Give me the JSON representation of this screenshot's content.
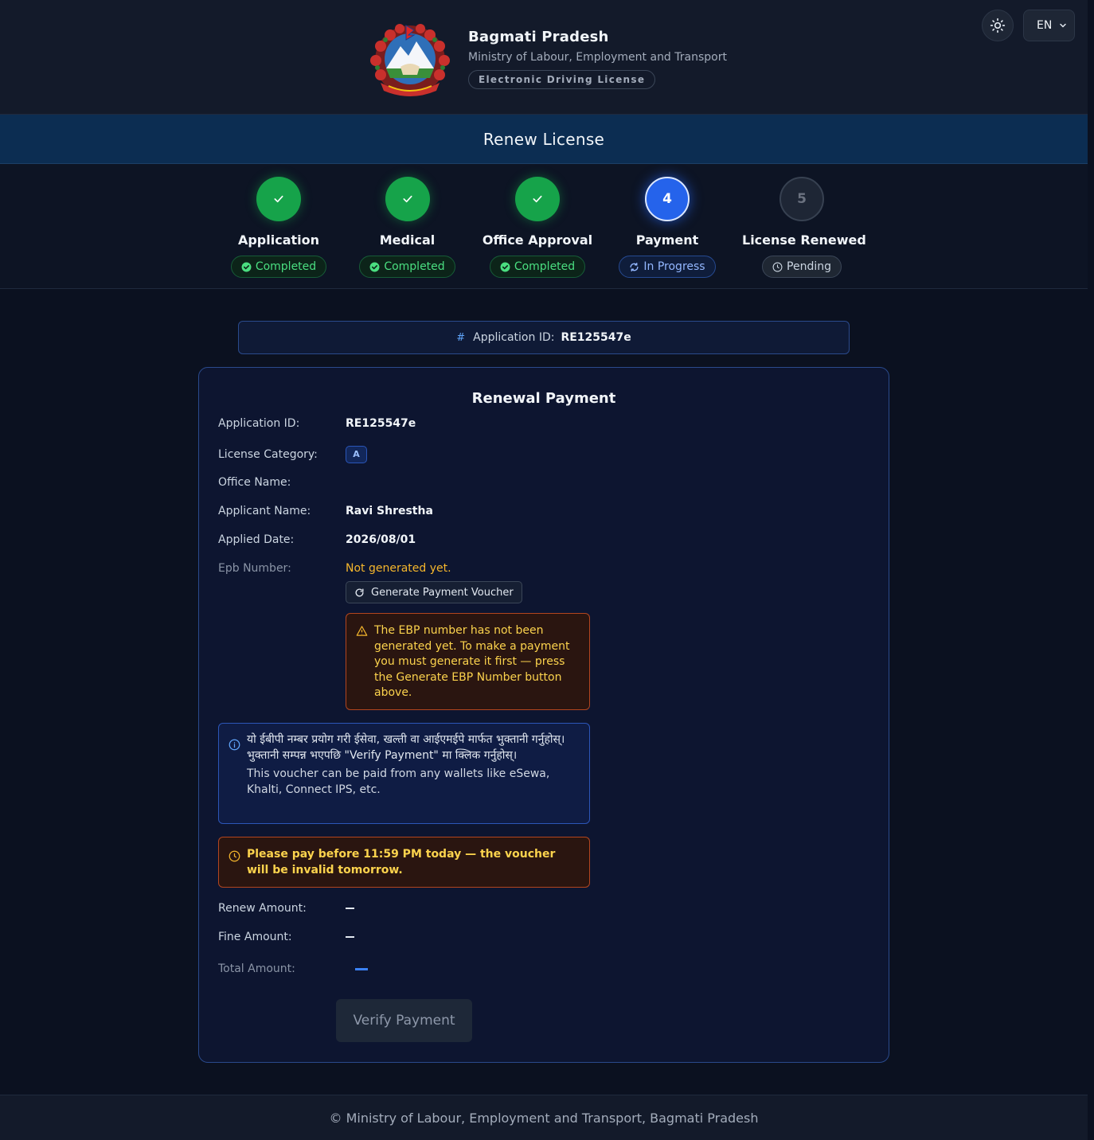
{
  "header": {
    "title": "Bagmati Pradesh",
    "subtitle": "Ministry of Labour, Employment and Transport",
    "badge": "Electronic Driving License",
    "language": "EN",
    "emblem_icon": "nepal-emblem-icon",
    "theme_icon": "sun-icon"
  },
  "page_title": "Renew License",
  "steps": [
    {
      "number": "1",
      "label": "Application",
      "status": "Completed",
      "state": "done"
    },
    {
      "number": "2",
      "label": "Medical",
      "status": "Completed",
      "state": "done"
    },
    {
      "number": "3",
      "label": "Office Approval",
      "status": "Completed",
      "state": "done"
    },
    {
      "number": "4",
      "label": "Payment",
      "status": "In Progress",
      "state": "active"
    },
    {
      "number": "5",
      "label": "License Renewed",
      "status": "Pending",
      "state": "pending"
    }
  ],
  "application_bar": {
    "label": "Application ID:",
    "value": "RE125547e"
  },
  "payment": {
    "title": "Renewal Payment",
    "fields": {
      "application_id": {
        "label": "Application ID:",
        "value": "RE125547e"
      },
      "license_category": {
        "label": "License Category:",
        "value": "A"
      },
      "office_name": {
        "label": "Office Name:",
        "value": ""
      },
      "applicant_name": {
        "label": "Applicant Name:",
        "value": "Ravi Shrestha"
      },
      "applied_date": {
        "label": "Applied Date:",
        "value": "2026/08/01"
      },
      "epb_number": {
        "label": "Epb Number:",
        "value": "Not generated yet."
      }
    },
    "generate_button": "Generate Payment Voucher",
    "warning_text": "The EBP number has not been generated yet. To make a payment you must generate it first — press the Generate EBP Number button above.",
    "info_nepali": "यो ईबीपी नम्बर प्रयोग गरी ईसेवा, खल्ती वा आईएमईपे मार्फत भुक्तानी गर्नुहोस्। भुक्तानी सम्पन्न भएपछि \"Verify Payment\" मा क्लिक गर्नुहोस्।",
    "info_english": "This voucher can be paid from any wallets like eSewa, Khalti, Connect IPS, etc.",
    "deadline_text": "Please pay before 11:59 PM today — the voucher will be invalid tomorrow.",
    "amounts": {
      "renew": {
        "label": "Renew Amount:"
      },
      "fine": {
        "label": "Fine Amount:"
      },
      "total": {
        "label": "Total Amount:"
      }
    },
    "verify_button": "Verify Payment"
  },
  "footer": "© Ministry of Labour, Employment and Transport, Bagmati Pradesh",
  "colors": {
    "background": "#0b1120",
    "title_bar": "#0c2d52",
    "done": "#16a34a",
    "active": "#2563eb",
    "warning": "#f5b62c",
    "card_border": "#2a4a8c"
  }
}
